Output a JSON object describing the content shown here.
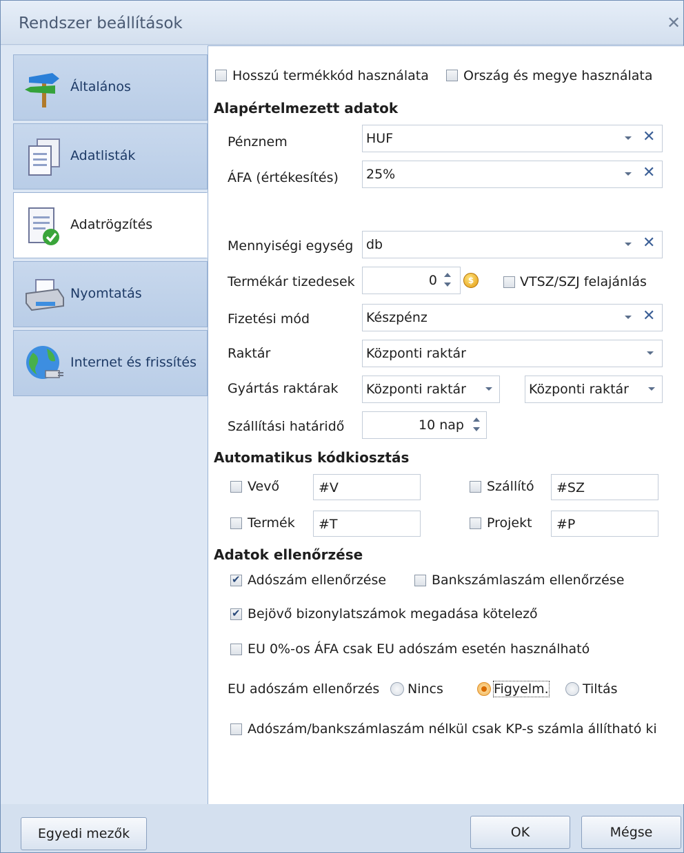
{
  "window": {
    "title": "Rendszer beállítások"
  },
  "nav": {
    "items": [
      {
        "label": "Általános",
        "icon": "signpost-icon"
      },
      {
        "label": "Adatlisták",
        "icon": "documents-icon"
      },
      {
        "label": "Adatrögzítés",
        "icon": "document-check-icon"
      },
      {
        "label": "Nyomtatás",
        "icon": "printer-icon"
      },
      {
        "label": "Internet és frissítés",
        "icon": "globe-plug-icon"
      }
    ],
    "active": "Adatrögzítés"
  },
  "top_options": {
    "long_code": {
      "label": "Hosszú termékkód használata",
      "checked": false
    },
    "country_county": {
      "label": "Ország és megye használata",
      "checked": false
    }
  },
  "defaults": {
    "heading": "Alapértelmezett adatok",
    "currency": {
      "label": "Pénznem",
      "value": "HUF"
    },
    "vat_sales": {
      "label": "ÁFA (értékesítés)",
      "value": "25%"
    },
    "unit": {
      "label": "Mennyiségi egység",
      "value": "db"
    },
    "price_decimals": {
      "label": "Termékár tizedesek",
      "value": "0"
    },
    "vtsz": {
      "label": "VTSZ/SZJ felajánlás",
      "checked": false
    },
    "payment": {
      "label": "Fizetési mód",
      "value": "Készpénz"
    },
    "warehouse": {
      "label": "Raktár",
      "value": "Központi raktár"
    },
    "production_wh": {
      "label": "Gyártás raktárak",
      "value1": "Központi raktár",
      "value2": "Központi raktár"
    },
    "delivery": {
      "label": "Szállítási határidő",
      "value": "10 nap"
    }
  },
  "auto_codes": {
    "heading": "Automatikus kódkiosztás",
    "customer": {
      "label": "Vevő",
      "value": "#V",
      "checked": false
    },
    "supplier": {
      "label": "Szállító",
      "value": "#SZ",
      "checked": false
    },
    "product": {
      "label": "Termék",
      "value": "#T",
      "checked": false
    },
    "project": {
      "label": "Projekt",
      "value": "#P",
      "checked": false
    }
  },
  "validation": {
    "heading": "Adatok ellenőrzése",
    "tax_number": {
      "label": "Adószám ellenőrzése",
      "checked": true
    },
    "bank_account": {
      "label": "Bankszámlaszám ellenőrzése",
      "checked": false
    },
    "incoming_docs": {
      "label": "Bejövő bizonylatszámok megadása kötelező",
      "checked": true
    },
    "eu_vat": {
      "label": "EU 0%-os ÁFA csak EU adószám esetén használható",
      "checked": false
    },
    "eu_check": {
      "label": "EU adószám ellenőrzés",
      "options": [
        "Nincs",
        "Figyelm.",
        "Tiltás"
      ],
      "selected": "Figyelm."
    },
    "cash_only": {
      "label": "Adószám/bankszámlaszám nélkül csak KP-s számla állítható ki",
      "checked": false
    }
  },
  "footer": {
    "custom_fields": "Egyedi mezők",
    "ok": "OK",
    "cancel": "Mégse"
  },
  "colors": {
    "accent": "#3b5f96",
    "window_bg": "#d4e0ef",
    "radio_selected": "#f0b050"
  }
}
